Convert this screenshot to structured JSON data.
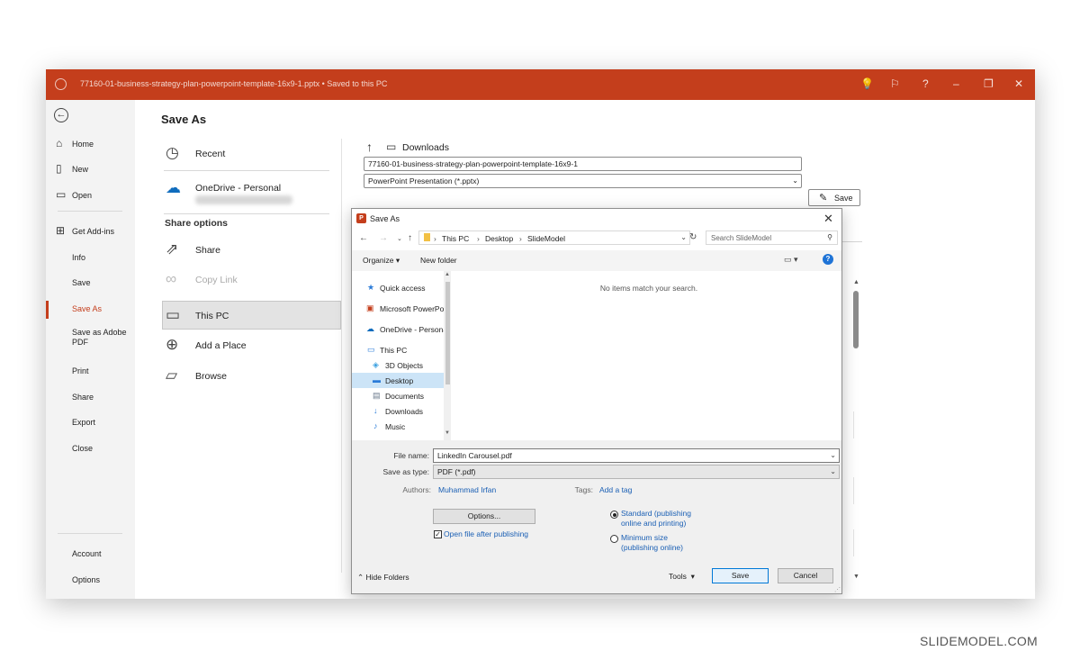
{
  "titlebar": {
    "document_title": "77160-01-business-strategy-plan-powerpoint-template-16x9-1.pptx • Saved to this PC",
    "icons": [
      "lightbulb-icon",
      "comments-icon",
      "help-icon",
      "minimize-icon",
      "restore-icon",
      "close-icon"
    ],
    "accent_color": "#c43e1c"
  },
  "left_nav": {
    "top_items": [
      {
        "label": "Home",
        "icon": "home-icon"
      },
      {
        "label": "New",
        "icon": "new-doc-icon"
      },
      {
        "label": "Open",
        "icon": "folder-open-icon"
      },
      {
        "label": "Get Add-ins",
        "icon": "addins-icon"
      }
    ],
    "items": [
      "Info",
      "Save",
      "Save As",
      "Save as Adobe PDF",
      "Print",
      "Share",
      "Export",
      "Close"
    ],
    "active_item": "Save As",
    "bottom_items": [
      "Account",
      "Options"
    ]
  },
  "backstage": {
    "title": "Save As",
    "locations": [
      "Recent",
      "OneDrive - Personal"
    ],
    "share_options_heading": "Share options",
    "share_locations": [
      "Share",
      "Copy Link"
    ],
    "other_locations": [
      "This PC",
      "Add a Place",
      "Browse"
    ],
    "selected_location": "This PC",
    "path_label": "Downloads",
    "filename_value": "77160-01-business-strategy-plan-powerpoint-template-16x9-1",
    "format_value": "PowerPoint Presentation (*.pptx)",
    "save_button": "Save"
  },
  "dialog": {
    "title": "Save As",
    "address": [
      "This PC",
      "Desktop",
      "SlideModel"
    ],
    "search_placeholder": "Search SlideModel",
    "toolbar": {
      "organize": "Organize ▾",
      "new_folder": "New folder"
    },
    "tree": [
      {
        "label": "Quick access",
        "icon": "star-icon"
      },
      {
        "label": "Microsoft PowerPoint",
        "icon": "powerpoint-icon"
      },
      {
        "label": "OneDrive - Personal",
        "icon": "onedrive-icon"
      },
      {
        "label": "This PC",
        "icon": "computer-icon"
      },
      {
        "label": "3D Objects",
        "icon": "3d-objects-icon"
      },
      {
        "label": "Desktop",
        "icon": "desktop-icon"
      },
      {
        "label": "Documents",
        "icon": "documents-icon"
      },
      {
        "label": "Downloads",
        "icon": "downloads-icon"
      },
      {
        "label": "Music",
        "icon": "music-icon"
      }
    ],
    "selected_tree_item": "Desktop",
    "empty_message": "No items match your search.",
    "file_name_label": "File name:",
    "file_name_value": "LinkedIn Carousel.pdf",
    "save_as_type_label": "Save as type:",
    "save_as_type_value": "PDF (*.pdf)",
    "authors_label": "Authors:",
    "authors_value": "Muhammad Irfan",
    "tags_label": "Tags:",
    "tags_value": "Add a tag",
    "options_button": "Options...",
    "open_after_label": "Open file after publishing",
    "open_after_checked": true,
    "optimize_options": [
      "Standard (publishing online and printing)",
      "Minimum size (publishing online)"
    ],
    "optimize_selected": "Standard (publishing online and printing)",
    "hide_folders": "Hide Folders",
    "tools": "Tools",
    "save_button": "Save",
    "cancel_button": "Cancel"
  },
  "watermark": "SLIDEMODEL.COM"
}
